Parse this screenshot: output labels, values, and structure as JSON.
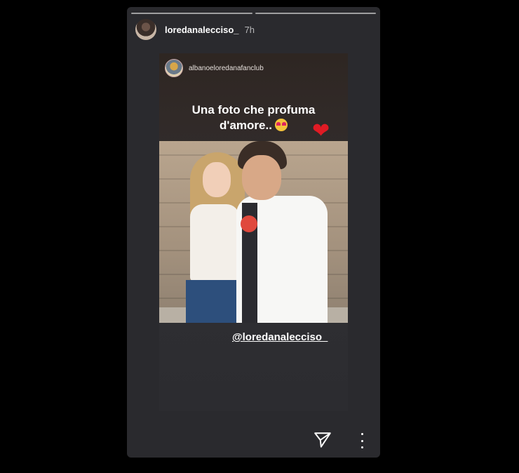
{
  "story": {
    "username": "loredanalecciso_",
    "time": "7h",
    "segments": 2
  },
  "shared_post": {
    "username": "albanoeloredanafanclub",
    "caption_line1": "Una foto che profuma",
    "caption_line2": "d'amore..",
    "mention": "@loredanalecciso_"
  },
  "icons": {
    "send": "send-icon",
    "more": "more-options-icon",
    "heart": "heart-sticker-icon",
    "emoji": "heart-eyes-emoji-icon"
  },
  "colors": {
    "background": "#000000",
    "story_bg": "#2a2a2e",
    "heart": "#e01b24"
  }
}
